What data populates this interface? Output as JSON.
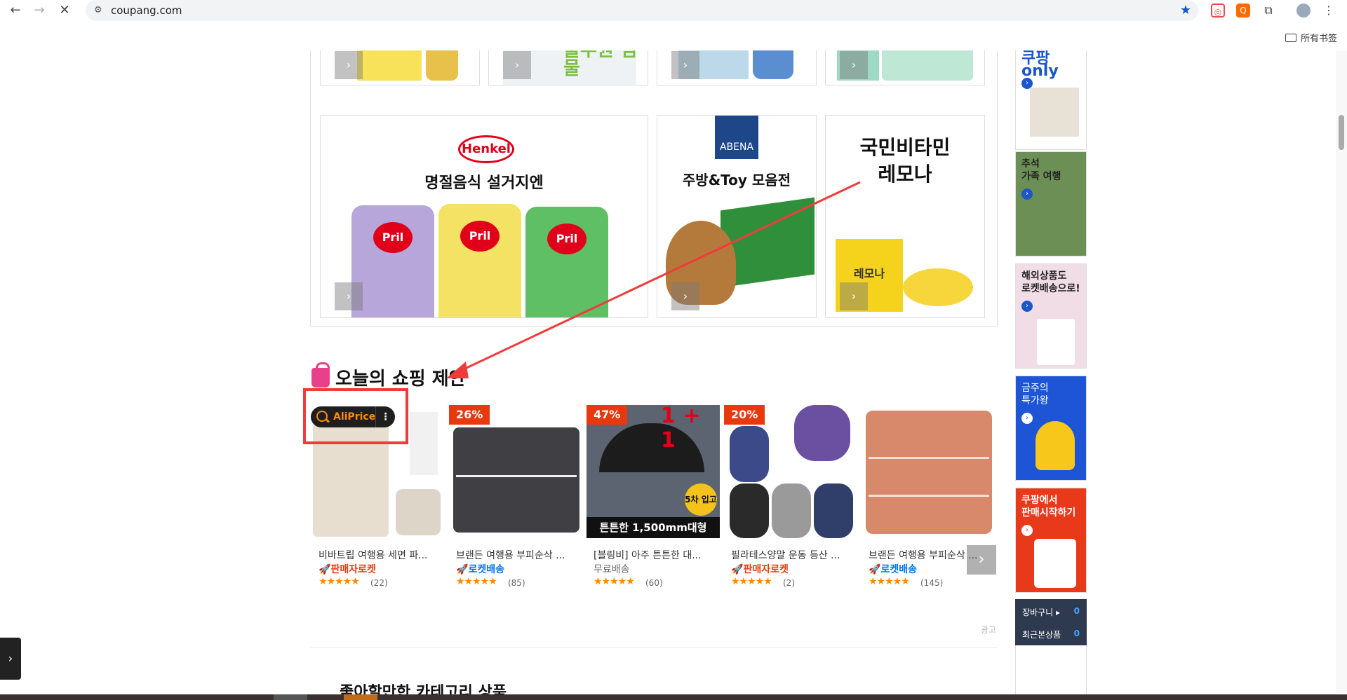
{
  "browser": {
    "url": "coupang.com",
    "bookmarks_all": "所有书签"
  },
  "banners": {
    "henkel_logo": "Henkel",
    "henkel_title": "명절음식 설거지엔",
    "pril_label": "Pril",
    "abena_logo": "ABENA",
    "abena_title": "주방&Toy 모음전",
    "lemona_title_line1": "국민비타민",
    "lemona_title_line2": "레모나",
    "lemona_bag_label": "레모나",
    "top_tile_text": "풀무원 샘물"
  },
  "section": {
    "title": "오늘의 쇼핑 제안",
    "ad_label": "광고"
  },
  "aliprice": {
    "label": "AliPrice",
    "more": "⋮"
  },
  "products": [
    {
      "name": "비바트립 여행용 세면 파...",
      "tag": "판매자로켓",
      "tag_type": "seller",
      "badge": "",
      "rating_stars": "★★★★★",
      "reviews": "(22)",
      "rating": 5
    },
    {
      "name": "브랜든 여행용 부피순삭 ...",
      "tag": "로켓배송",
      "tag_type": "rocket",
      "badge": "26%",
      "rating_stars": "★★★★★",
      "reviews": "(85)",
      "rating": 4.5
    },
    {
      "name": "[블링비] 아주 튼튼한 대...",
      "tag": "무료배송",
      "tag_type": "free",
      "badge": "47%",
      "rating_stars": "★★★★★",
      "reviews": "(60)",
      "rating": 5,
      "img_text_top": "1 + 1",
      "img_text_bottom": "튼튼한 1,500mm대형",
      "img_badge": "5차 입고"
    },
    {
      "name": "필라테스양말 운동 등산 ...",
      "tag": "판매자로켓",
      "tag_type": "seller",
      "badge": "20%",
      "rating_stars": "★★★★★",
      "reviews": "(2)",
      "rating": 5
    },
    {
      "name": "브랜든 여행용 부피순삭 ...",
      "tag": "로켓배송",
      "tag_type": "rocket",
      "badge": "",
      "rating_stars": "★★★★★",
      "reviews": "(145)",
      "rating": 5
    }
  ],
  "sidebar": {
    "cards": [
      {
        "text": "쿠팡only"
      },
      {
        "text": "추석\n가족 여행"
      },
      {
        "text": "해외상품도\n로켓배송으로!"
      },
      {
        "text": "금주의\n특가왕"
      },
      {
        "text": "쿠팡에서\n판매시작하기"
      }
    ],
    "cart_label": "장바구니 ▸",
    "cart_count": "0",
    "recent_label": "최근본상품",
    "recent_count": "0"
  },
  "next_section": "좋아할만한 카테고리 상품",
  "colors": {
    "badge": "#e8380d",
    "rocket": "#0073e9",
    "seller_rocket": "#e8380d",
    "annotation_red": "#f03b3b",
    "aliprice_orange": "#ff8a00"
  }
}
